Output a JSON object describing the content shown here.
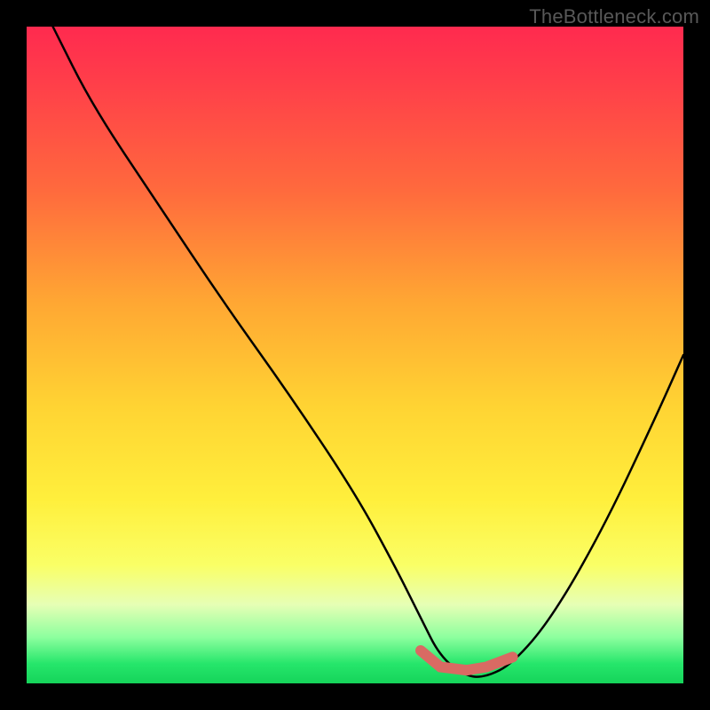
{
  "attribution": "TheBottleneck.com",
  "chart_data": {
    "type": "line",
    "title": "",
    "xlabel": "",
    "ylabel": "",
    "xlim": [
      0,
      100
    ],
    "ylim": [
      0,
      100
    ],
    "series": [
      {
        "name": "bottleneck-curve",
        "x": [
          4,
          10,
          20,
          30,
          40,
          50,
          56,
          60,
          63,
          67,
          70,
          74,
          80,
          88,
          96,
          100
        ],
        "y": [
          100,
          88,
          73,
          58,
          44,
          29,
          18,
          10,
          4,
          1,
          1,
          3,
          10,
          24,
          41,
          50
        ]
      }
    ],
    "highlight_segment": {
      "name": "sweet-spot",
      "color": "#d96a63",
      "x": [
        60,
        63,
        67,
        70,
        74
      ],
      "y": [
        5,
        2.5,
        2,
        2.5,
        4
      ]
    },
    "gradient_stops": [
      {
        "pos": 0,
        "color": "#ff2a4f"
      },
      {
        "pos": 25,
        "color": "#ff6a3d"
      },
      {
        "pos": 58,
        "color": "#ffd433"
      },
      {
        "pos": 82,
        "color": "#faff66"
      },
      {
        "pos": 93,
        "color": "#8cff9e"
      },
      {
        "pos": 100,
        "color": "#15d45a"
      }
    ]
  }
}
